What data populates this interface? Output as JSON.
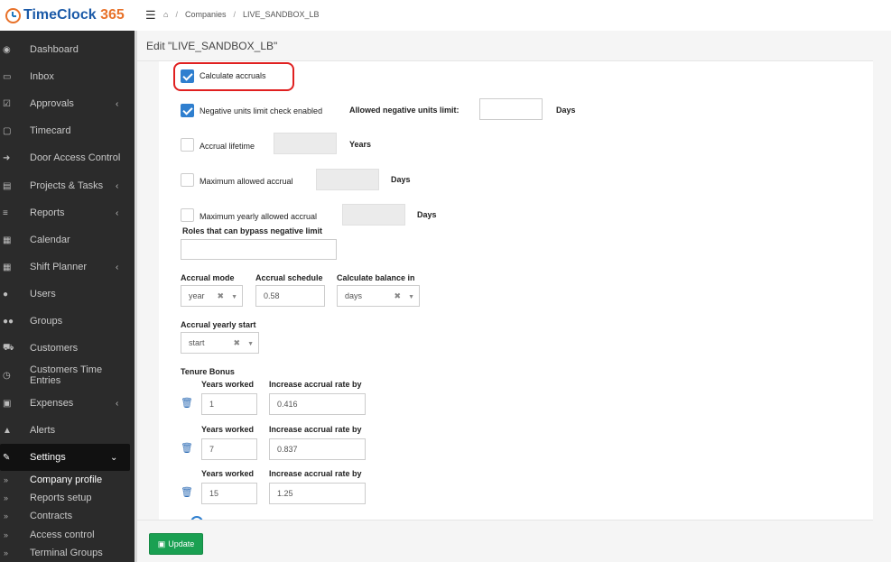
{
  "app": {
    "logo_name": "TimeClock",
    "logo_number": "365"
  },
  "breadcrumb": {
    "home_icon": "home-icon",
    "items": [
      "Companies",
      "LIVE_SANDBOX_LB"
    ]
  },
  "sidebar": {
    "items": [
      {
        "label": "Dashboard",
        "icon": "dashboard-icon",
        "chevron": ""
      },
      {
        "label": "Inbox",
        "icon": "inbox-icon",
        "chevron": ""
      },
      {
        "label": "Approvals",
        "icon": "check-square-icon",
        "chevron": "‹"
      },
      {
        "label": "Timecard",
        "icon": "calendar-icon",
        "chevron": ""
      },
      {
        "label": "Door Access Control",
        "icon": "sign-in-icon",
        "chevron": ""
      },
      {
        "label": "Projects & Tasks",
        "icon": "tasks-icon",
        "chevron": "‹"
      },
      {
        "label": "Reports",
        "icon": "list-icon",
        "chevron": "‹"
      },
      {
        "label": "Calendar",
        "icon": "calendar-grid-icon",
        "chevron": ""
      },
      {
        "label": "Shift Planner",
        "icon": "table-icon",
        "chevron": "‹"
      },
      {
        "label": "Users",
        "icon": "user-icon",
        "chevron": ""
      },
      {
        "label": "Groups",
        "icon": "users-icon",
        "chevron": ""
      },
      {
        "label": "Customers",
        "icon": "cart-icon",
        "chevron": ""
      },
      {
        "label": "Customers Time Entries",
        "icon": "clock-icon",
        "chevron": ""
      },
      {
        "label": "Expenses",
        "icon": "money-icon",
        "chevron": "‹"
      },
      {
        "label": "Alerts",
        "icon": "bell-icon",
        "chevron": ""
      },
      {
        "label": "Settings",
        "icon": "wrench-icon",
        "chevron": "⌄"
      }
    ],
    "sub_items": [
      {
        "label": "Company profile"
      },
      {
        "label": "Reports setup"
      },
      {
        "label": "Contracts"
      },
      {
        "label": "Access control"
      },
      {
        "label": "Terminal Groups"
      }
    ]
  },
  "page": {
    "title": "Edit \"LIVE_SANDBOX_LB\""
  },
  "form": {
    "calculate_accruals": {
      "label": "Calculate accruals",
      "checked": true
    },
    "negative_units": {
      "label": "Negative units limit check enabled",
      "checked": true
    },
    "allowed_negative": {
      "label": "Allowed negative units limit:",
      "value": "",
      "unit": "Days"
    },
    "accrual_lifetime": {
      "label": "Accrual lifetime",
      "checked": false,
      "value": "",
      "unit": "Years"
    },
    "max_allowed_accrual": {
      "label": "Maximum allowed accrual",
      "checked": false,
      "value": "",
      "unit": "Days"
    },
    "max_yearly_accrual": {
      "label": "Maximum yearly allowed accrual",
      "checked": false,
      "value": "",
      "unit": "Days"
    },
    "roles_bypass": {
      "label": "Roles that can bypass negative limit",
      "value": ""
    },
    "accrual_mode": {
      "label": "Accrual mode",
      "value": "year"
    },
    "accrual_schedule": {
      "label": "Accrual schedule",
      "value": "0.58"
    },
    "calculate_balance_in": {
      "label": "Calculate balance in",
      "value": "days"
    },
    "accrual_yearly_start": {
      "label": "Accrual yearly start",
      "value": "start"
    },
    "tenure_bonus": {
      "label": "Tenure Bonus",
      "years_label": "Years worked",
      "rate_label": "Increase accrual rate by",
      "rows": [
        {
          "years": "1",
          "rate": "0.416"
        },
        {
          "years": "7",
          "rate": "0.837"
        },
        {
          "years": "15",
          "rate": "1.25"
        }
      ]
    }
  },
  "footer": {
    "update_label": "Update"
  },
  "colors": {
    "accent": "#2f7fcf",
    "sidebar": "#2b2b2b",
    "update": "#1aa052",
    "highlight": "#e02020",
    "logo_orange": "#e8722a",
    "logo_blue": "#1b5aa8"
  }
}
